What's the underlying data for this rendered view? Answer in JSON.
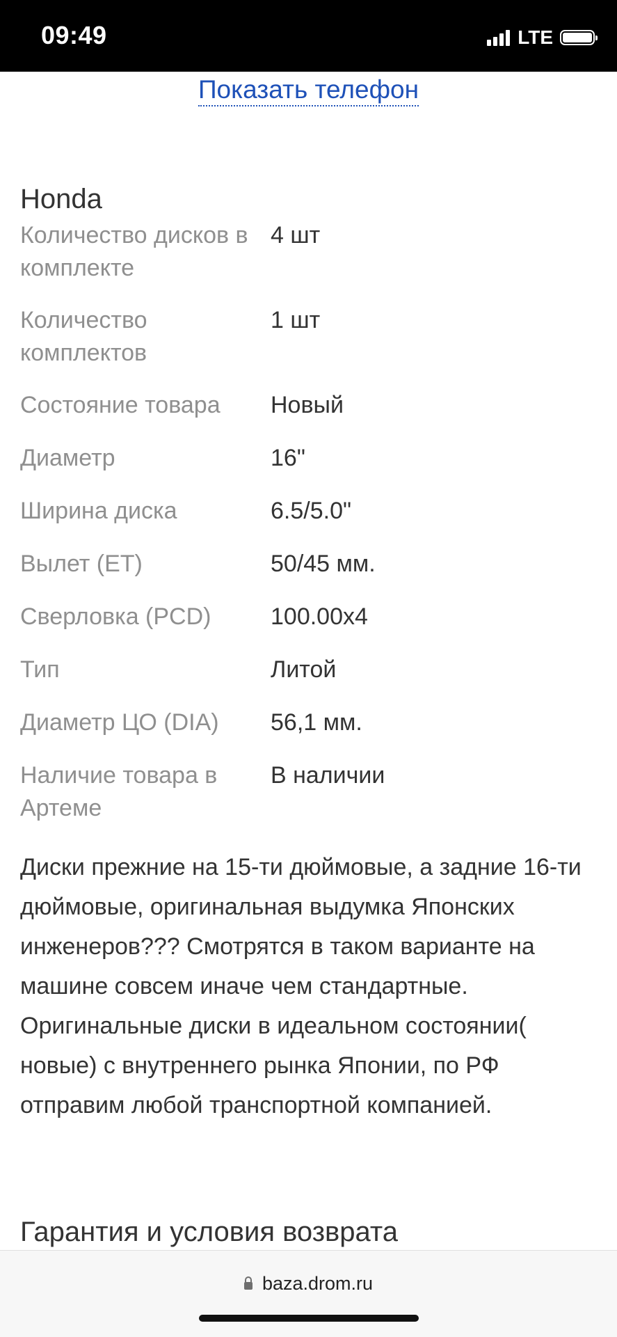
{
  "status_bar": {
    "time": "09:49",
    "network": "LTE",
    "signal_bars": 4,
    "battery_level": 1.0
  },
  "contact": {
    "show_phone_label": "Показать телефон"
  },
  "listing": {
    "brand": "Honda",
    "specs": [
      {
        "label": "Количество дисков в комплекте",
        "value": "4 шт"
      },
      {
        "label": "Количество комплектов",
        "value": "1 шт"
      },
      {
        "label": "Состояние товара",
        "value": "Новый"
      },
      {
        "label": "Диаметр",
        "value": "16\""
      },
      {
        "label": "Ширина диска",
        "value": "6.5/5.0\""
      },
      {
        "label": "Вылет (ET)",
        "value": "50/45 мм."
      },
      {
        "label": "Сверловка (PCD)",
        "value": "100.00x4"
      },
      {
        "label": "Тип",
        "value": "Литой"
      },
      {
        "label": "Диаметр ЦО (DIA)",
        "value": "56,1 мм."
      },
      {
        "label": "Наличие товара в Артеме",
        "value": "В наличии"
      }
    ],
    "description": "Диски прежние на 15-ти дюймовые, а задние 16-ти дюймовые, оригинальная выдумка Японских инженеров??? Смотрятся в таком варианте на машине совсем иначе чем стандартные. Оригинальные диски в идеальном состоянии( новые) с внутреннего рынка Японии, по РФ отправим любой транспортной компанией.",
    "warranty_title": "Гарантия и условия возврата"
  },
  "browser": {
    "url": "baza.drom.ru",
    "lock_icon": "lock-icon"
  },
  "colors": {
    "link": "#1e51b8",
    "label": "#8f8f8f",
    "text": "#333333"
  }
}
